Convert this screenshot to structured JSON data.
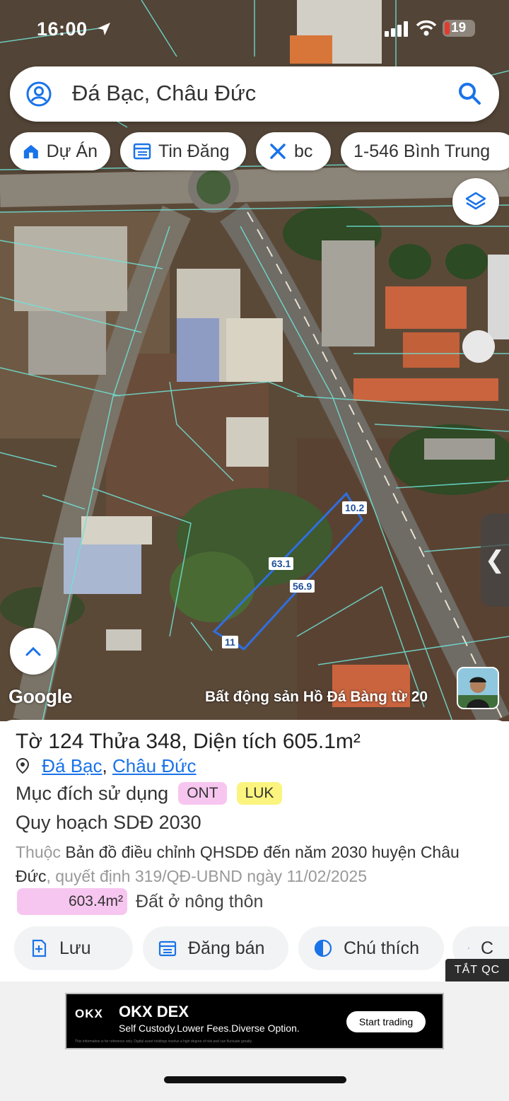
{
  "status_bar": {
    "time": "16:00",
    "battery": "19"
  },
  "search": {
    "query": "Đá Bạc, Châu Đức"
  },
  "chips": [
    {
      "label": "Dự Án",
      "icon": "house-icon"
    },
    {
      "label": "Tin Đăng",
      "icon": "list-icon"
    },
    {
      "label": "bc",
      "icon": "tools-icon"
    },
    {
      "label": "1-546 Bình Trung",
      "icon": ""
    }
  ],
  "map": {
    "attribution": "Google",
    "credit": "Bất động sản Hồ Đá Bàng từ 20",
    "measurements": [
      "10.2",
      "63.1",
      "56.9",
      "11"
    ]
  },
  "parcel": {
    "sheet_label": "Tờ",
    "sheet": "124",
    "lot_label": "Thửa",
    "lot": "348",
    "area_label": "Diện tích",
    "area": "605.1m²",
    "commune": "Đá Bạc",
    "separator": ",",
    "district": "Châu Đức",
    "usage_label": "Mục đích sử dụng",
    "usage_tags": [
      "ONT",
      "LUK"
    ],
    "plan_title": "Quy hoạch SDĐ 2030",
    "plan_prefix": "Thuộc",
    "plan_map": "Bản đồ điều chỉnh QHSDĐ đến năm 2030 huyện Châu Đức",
    "plan_decision": ", quyết định 319/QĐ-UBND ngày 11/02/2025",
    "plan_area": "603.4m²",
    "plan_area_type": "Đất ở nông thôn"
  },
  "actions": [
    {
      "label": "Lưu",
      "icon": "save-plus-icon"
    },
    {
      "label": "Đăng bán",
      "icon": "calendar-icon"
    },
    {
      "label": "Chú thích",
      "icon": "half-circle-icon"
    },
    {
      "label": "C",
      "icon": "camera-icon"
    }
  ],
  "ad_close": "TẮT QC",
  "ad": {
    "logo": "OKX",
    "title": "OKX DEX",
    "subtitle": "Self Custody.Lower Fees.Diverse Option.",
    "cta": "Start trading",
    "fine_print": "This information is for reference only. Digital asset holdings involve a high degree of risk and can fluctuate greatly."
  },
  "colors": {
    "accent": "#1a73e8",
    "parcel_outline": "#2f6fe0",
    "ont_tag": "#f7c6f0",
    "luk_tag": "#fbf47e"
  }
}
